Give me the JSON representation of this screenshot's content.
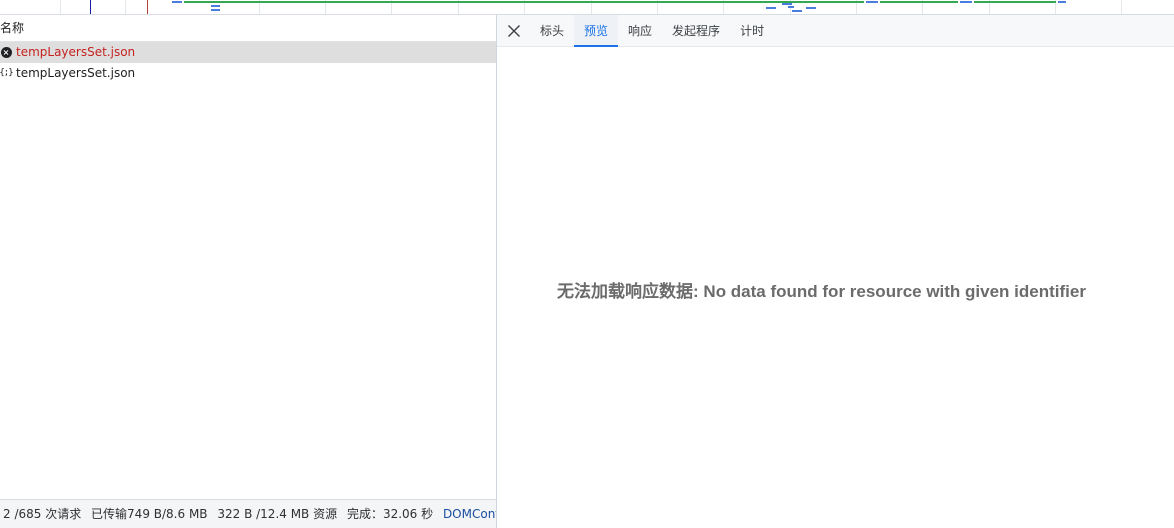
{
  "timeline": {
    "accent_blue": "#1a1aa6",
    "accent_red": "#b0413e",
    "green": "#34a853",
    "blue": "#4a7de0"
  },
  "request_list": {
    "column_name": "名称",
    "rows": [
      {
        "name": "tempLayersSet.json",
        "status": "error",
        "icon": "error-icon"
      },
      {
        "name": "tempLayersSet.json",
        "status": "ok",
        "icon": "json-icon",
        "icon_glyph": "{;}"
      }
    ]
  },
  "status_bar": {
    "requests": "2 /685 次请求",
    "transferred": "已传输749 B/8.6 MB",
    "resources": "322 B /12.4 MB 资源",
    "finish": "完成：32.06 秒",
    "dom_content_loaded": "DOMContentLoad"
  },
  "detail": {
    "close_icon": "close-icon",
    "tabs": [
      "标头",
      "预览",
      "响应",
      "发起程序",
      "计时"
    ],
    "active_tab": "预览",
    "message": "无法加载响应数据: No data found for resource with given identifier"
  }
}
